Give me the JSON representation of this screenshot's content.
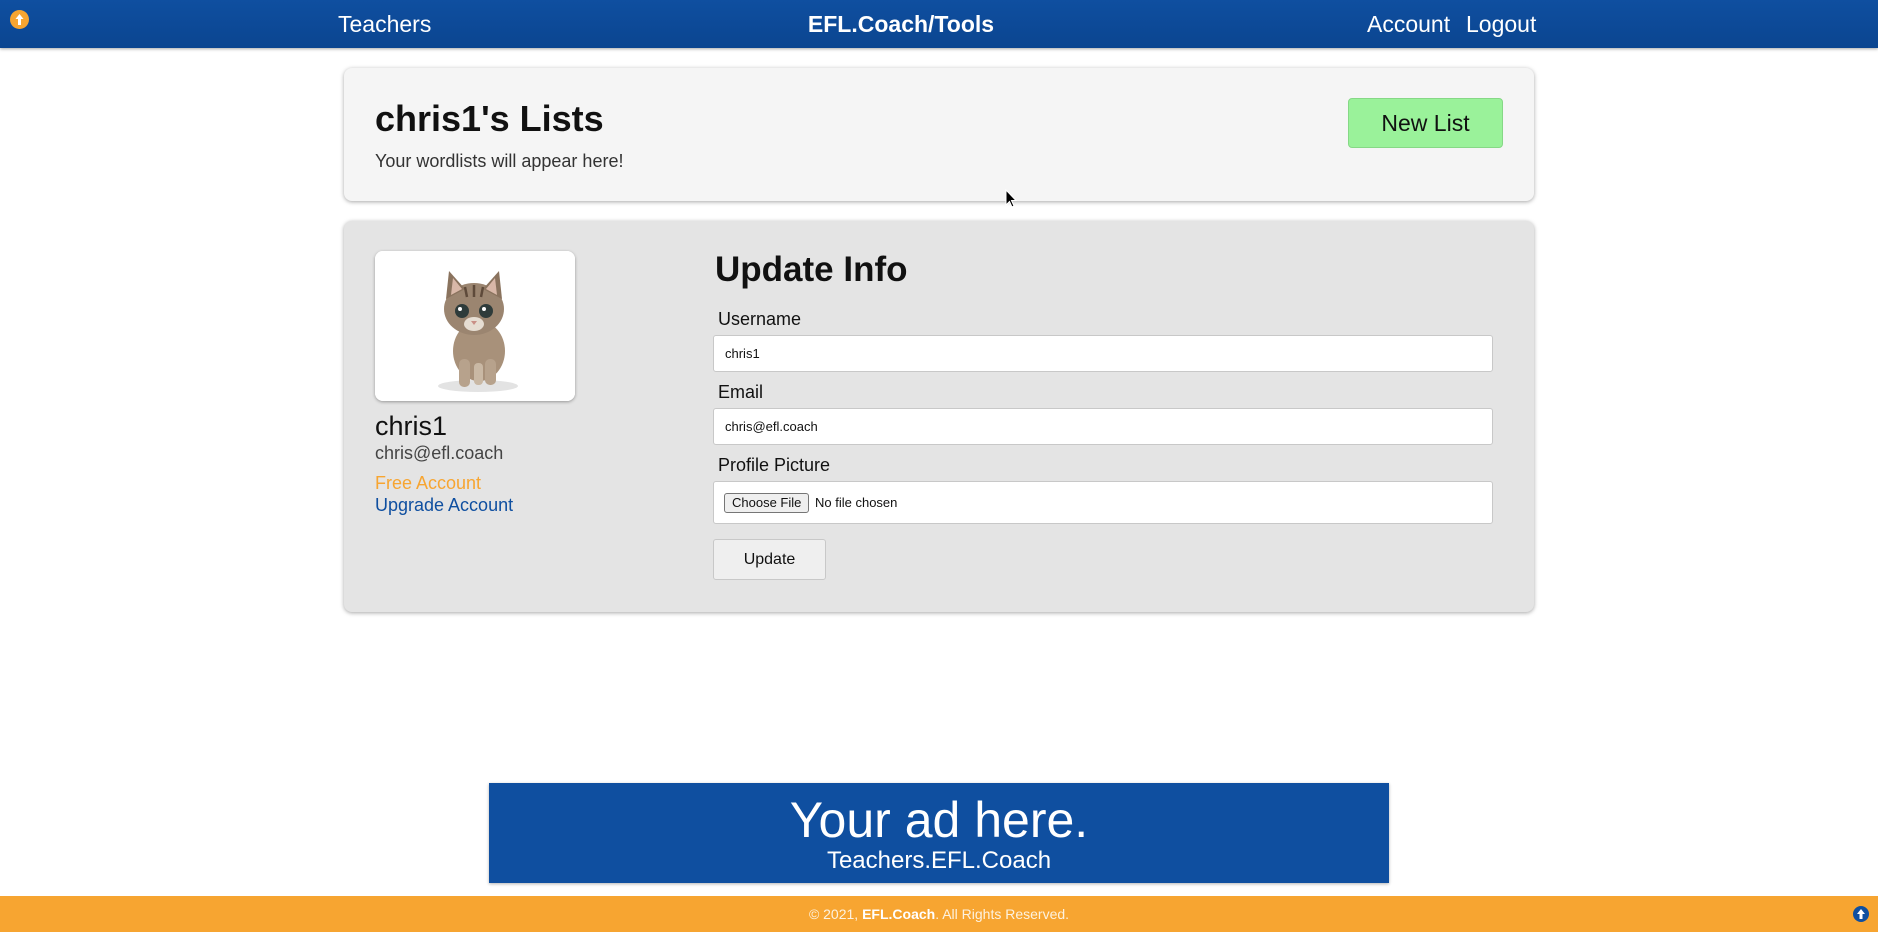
{
  "nav": {
    "left_link": "Teachers",
    "brand": "EFL.Coach/Tools",
    "account": "Account",
    "logout": "Logout",
    "badge_icon": "up-arrow-badge-icon"
  },
  "lists": {
    "title": "chris1's Lists",
    "subtitle": "Your wordlists will appear here!",
    "new_list_label": "New List"
  },
  "profile": {
    "name": "chris1",
    "email": "chris@efl.coach",
    "plan": "Free Account",
    "upgrade_label": "Upgrade Account",
    "avatar_description": "kitten-photo"
  },
  "form": {
    "title": "Update Info",
    "username_label": "Username",
    "username_value": "chris1",
    "email_label": "Email",
    "email_value": "chris@efl.coach",
    "picture_label": "Profile Picture",
    "choose_file_label": "Choose File",
    "file_status": "No file chosen",
    "update_label": "Update"
  },
  "ad": {
    "headline": "Your ad here.",
    "subline": "Teachers.EFL.Coach"
  },
  "footer": {
    "copyright": "© 2021,",
    "brand": "EFL.Coach",
    "rights": ". All Rights Reserved."
  },
  "colors": {
    "primary": "#0f4fa0",
    "accent": "#f7a531",
    "new_list": "#9af29a"
  }
}
